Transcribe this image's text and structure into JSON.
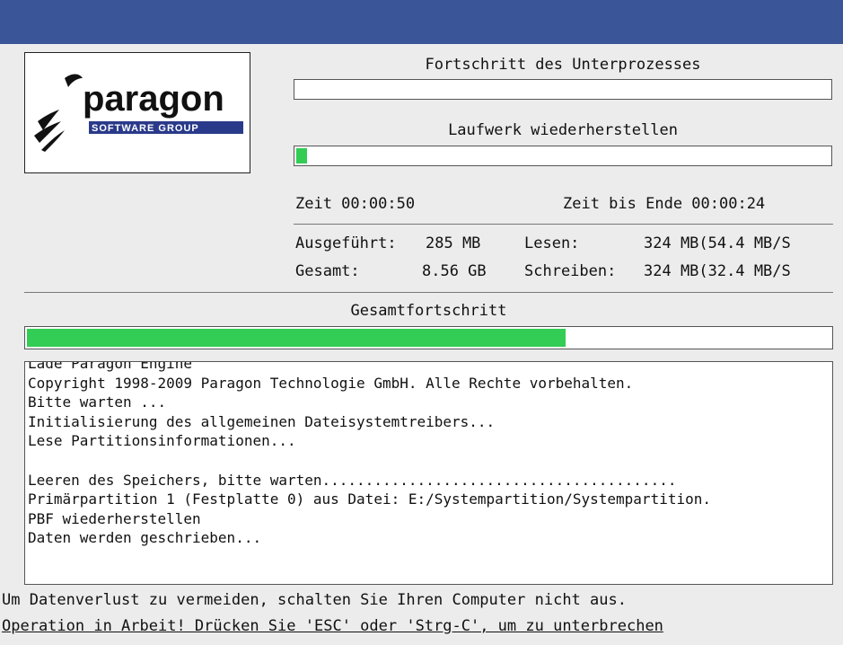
{
  "window": {
    "title_bar_color": "#3a5598",
    "background": "#ececec"
  },
  "logo": {
    "brand": "paragon",
    "tagline": "SOFTWARE GROUP"
  },
  "sub_progress": {
    "label": "Fortschritt des Unterprozesses",
    "fraction": 0.0
  },
  "drive_restore": {
    "label": "Laufwerk wiederherstellen",
    "fraction": 0.02
  },
  "time": {
    "elapsed_label": "Zeit 00:00:50",
    "remaining_label": "Zeit bis Ende 00:00:24"
  },
  "stats": {
    "done_label": "Ausgeführt:",
    "done_value": "285 MB",
    "total_label": "Gesamt:",
    "total_value": "8.56 GB",
    "read_label": "Lesen:",
    "read_value": "324 MB(54.4 MB/S",
    "write_label": "Schreiben:",
    "write_value": "324 MB(32.4 MB/S"
  },
  "overall": {
    "label": "Gesamtfortschritt",
    "fraction": 0.67
  },
  "log_lines": [
    "Lade Paragon Engine",
    "Copyright 1998-2009 Paragon Technologie GmbH. Alle Rechte vorbehalten.",
    "Bitte warten ...",
    "Initialisierung des allgemeinen Dateisystemtreibers...",
    "Lese Partitionsinformationen...",
    "",
    "Leeren des Speichers, bitte warten.........................................",
    "Primärpartition 1 (Festplatte 0) aus Datei: E:/Systempartition/Systempartition.",
    "PBF wiederherstellen",
    "Daten werden geschrieben..."
  ],
  "footer": {
    "warning": "Um Datenverlust zu vermeiden, schalten Sie Ihren Computer nicht aus.",
    "hint": "Operation in Arbeit! Drücken Sie 'ESC' oder 'Strg-C', um zu unterbrechen"
  },
  "colors": {
    "progress_fill": "#33cc55"
  }
}
